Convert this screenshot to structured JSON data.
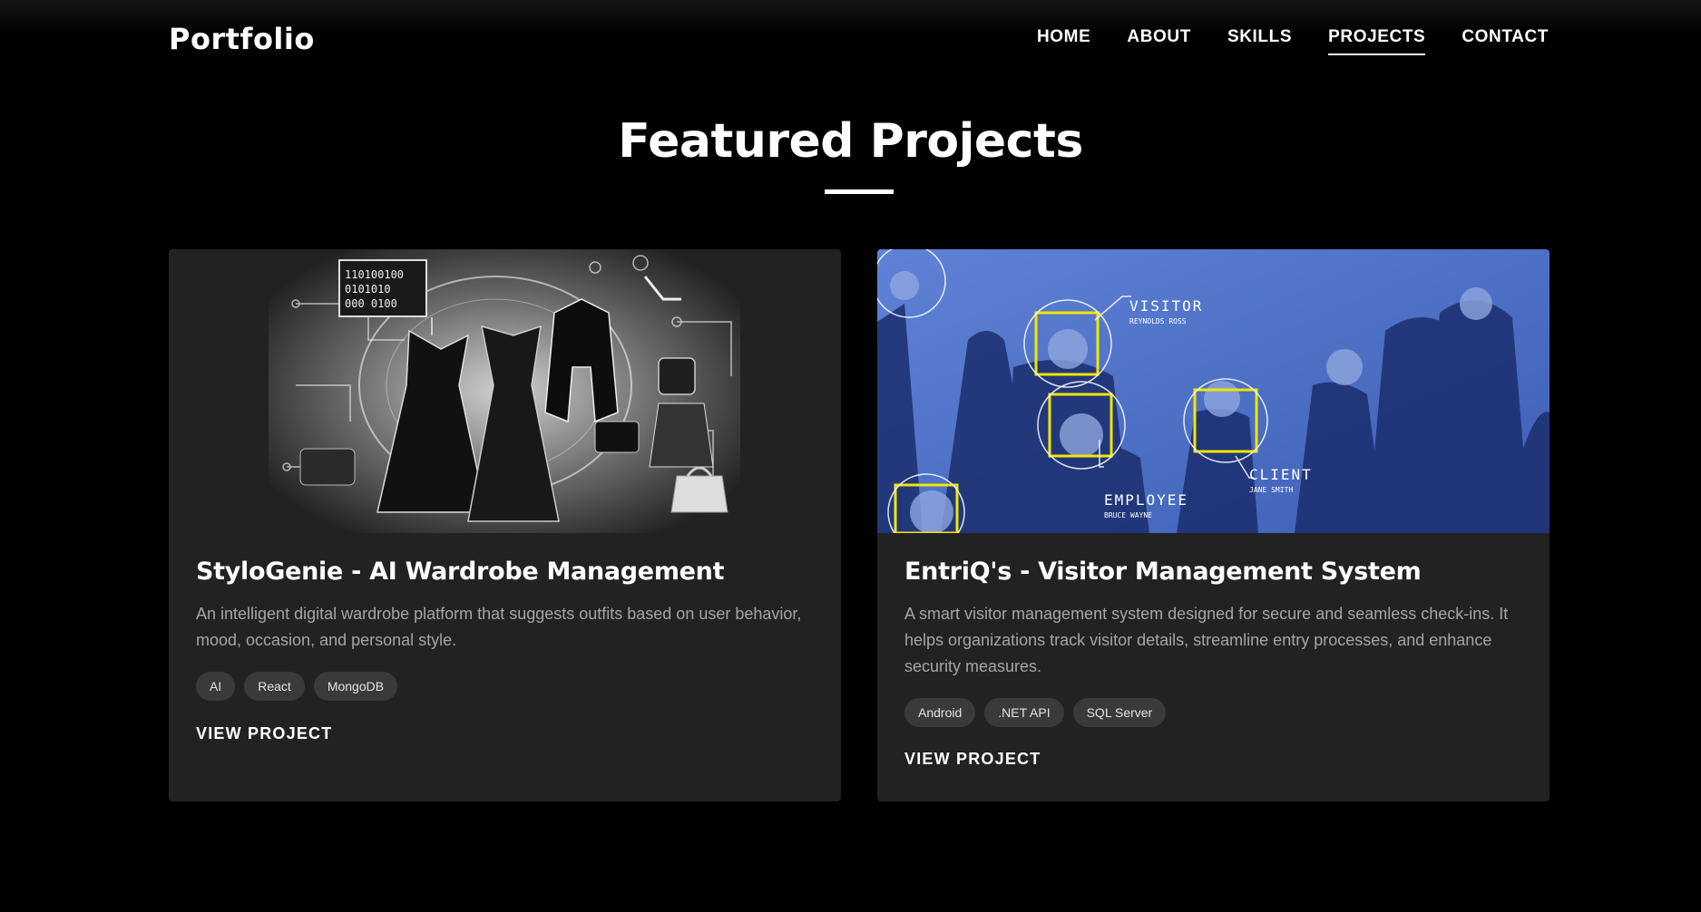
{
  "header": {
    "brand": "Portfolio",
    "nav": [
      {
        "label": "HOME"
      },
      {
        "label": "ABOUT"
      },
      {
        "label": "SKILLS"
      },
      {
        "label": "PROJECTS",
        "active": true
      },
      {
        "label": "CONTACT"
      }
    ]
  },
  "section": {
    "title": "Featured Projects"
  },
  "projects": [
    {
      "title": "StyloGenie - AI Wardrobe Management",
      "description": "An intelligent digital wardrobe platform that suggests outfits based on user behavior, mood, occasion, and personal style.",
      "tags": [
        "AI",
        "React",
        "MongoDB"
      ],
      "link_label": "VIEW PROJECT",
      "image": {
        "binary_text": [
          "110100100",
          "0101010",
          "000 0100"
        ]
      }
    },
    {
      "title": "EntriQ's - Visitor Management System",
      "description": "A smart visitor management system designed for secure and seamless check-ins. It helps organizations track visitor details, streamline entry processes, and enhance security measures.",
      "tags": [
        "Android",
        ".NET API",
        "SQL Server"
      ],
      "link_label": "VIEW PROJECT",
      "image": {
        "face_labels": [
          {
            "label": "VISITOR",
            "name": "REYNOLDS ROSS"
          },
          {
            "label": "EMPLOYEE",
            "name": "BRUCE WAYNE"
          },
          {
            "label": "CLIENT",
            "name": "JANE SMITH"
          }
        ]
      }
    }
  ],
  "colors": {
    "background": "#000000",
    "card": "#222222",
    "tag_bg": "#3a3a3a",
    "muted_text": "#a6a6a6",
    "accent_blue": "#4a6fc4",
    "scan_yellow": "#f2e600"
  }
}
